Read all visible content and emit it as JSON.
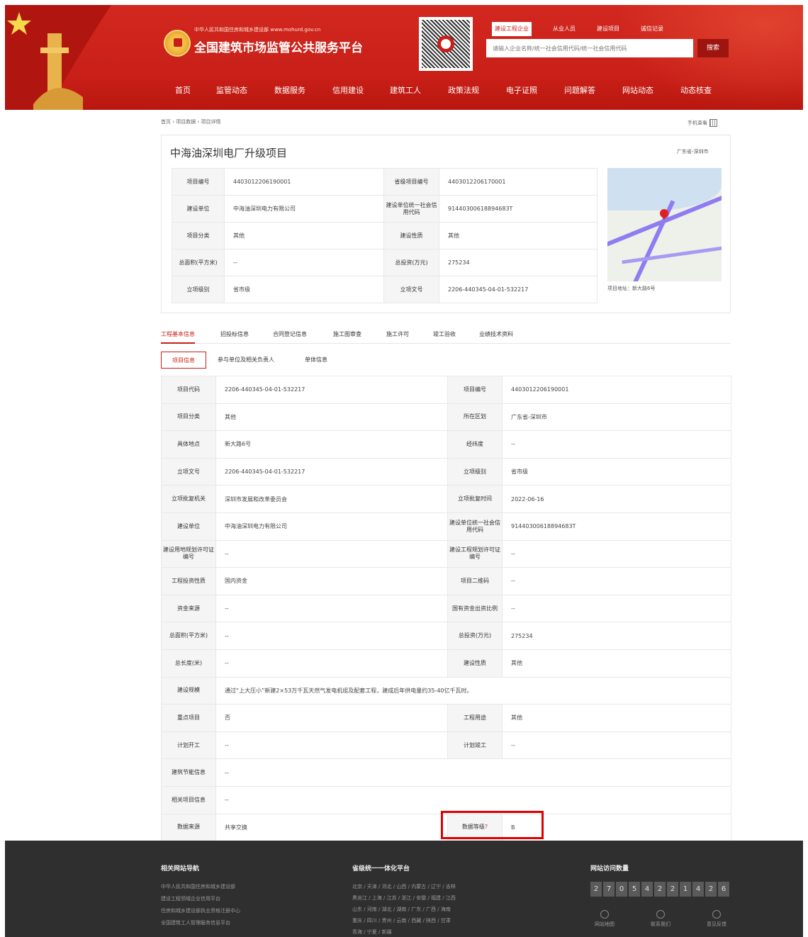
{
  "header": {
    "site_subtitle": "中华人民共和国住房和城乡建设部 www.mohurd.gov.cn",
    "site_title": "全国建筑市场监管公共服务平台",
    "search_tabs": [
      "建设工程企业",
      "从业人员",
      "建设项目",
      "诚信记录"
    ],
    "search_placeholder": "请输入企业名称/统一社会信用代码/统一社会信用代码",
    "search_button": "搜索",
    "nav": [
      "首页",
      "监管动态",
      "数据服务",
      "信用建设",
      "建筑工人",
      "政策法规",
      "电子证照",
      "问题解答",
      "网站动态",
      "动态核查"
    ]
  },
  "breadcrumb": "首页 › 项目数据 › 项目详情",
  "mobile_view": "手机查看",
  "project": {
    "title": "中海油深圳电厂升级项目",
    "region": "广东省-深圳市",
    "summary": [
      {
        "l1": "项目编号",
        "v1": "4403012206190001",
        "l2": "省级项目编号",
        "v2": "4403012206170001"
      },
      {
        "l1": "建设单位",
        "v1": "中海油深圳电力有限公司",
        "l2": "建设单位统一社会信用代码",
        "v2": "91440300618894683T"
      },
      {
        "l1": "项目分类",
        "v1": "其他",
        "l2": "建设性质",
        "v2": "其他"
      },
      {
        "l1": "总面积(平方米)",
        "v1": "--",
        "l2": "总投资(万元)",
        "v2": "275234"
      },
      {
        "l1": "立项级别",
        "v1": "省市级",
        "l2": "立项文号",
        "v2": "2206-440345-04-01-532217"
      }
    ],
    "map_address": "项目地址：新大路6号"
  },
  "main_tabs": [
    "工程基本信息",
    "招投标信息",
    "合同登记信息",
    "施工图审查",
    "施工许可",
    "竣工验收",
    "业绩技术资料"
  ],
  "sub_tabs": [
    "项目信息",
    "参与单位及相关负责人",
    "单体信息"
  ],
  "detail": [
    {
      "l1": "项目代码",
      "v1": "2206-440345-04-01-532217",
      "l2": "项目编号",
      "v2": "4403012206190001"
    },
    {
      "l1": "项目分类",
      "v1": "其他",
      "l2": "所在区划",
      "v2": "广东省-深圳市"
    },
    {
      "l1": "具体地点",
      "v1": "新大路6号",
      "l2": "经纬度",
      "v2": "--"
    },
    {
      "l1": "立项文号",
      "v1": "2206-440345-04-01-532217",
      "l2": "立项级别",
      "v2": "省市级"
    },
    {
      "l1": "立项批复机关",
      "v1": "深圳市发展和改革委员会",
      "l2": "立项批复时间",
      "v2": "2022-06-16"
    },
    {
      "l1": "建设单位",
      "v1": "中海油深圳电力有限公司",
      "l2": "建设单位统一社会信用代码",
      "v2": "91440300618894683T"
    },
    {
      "l1": "建设用地规划许可证编号",
      "v1": "--",
      "l2": "建设工程规划许可证编号",
      "v2": "--"
    },
    {
      "l1": "工程投资性质",
      "v1": "国内资金",
      "l2": "项目二维码",
      "v2": "--"
    },
    {
      "l1": "资金来源",
      "v1": "--",
      "l2": "国有资金出资比例",
      "v2": "--"
    },
    {
      "l1": "总面积(平方米)",
      "v1": "--",
      "l2": "总投资(万元)",
      "v2": "275234"
    },
    {
      "l1": "总长度(米)",
      "v1": "--",
      "l2": "建设性质",
      "v2": "其他"
    },
    {
      "l1": "建设规模",
      "v1": "通过“上大压小”新建2×53万千瓦天然气发电机组及配套工程，建成后年供电量约35-40亿千瓦时。",
      "full": true
    },
    {
      "l1": "重点项目",
      "v1": "否",
      "l2": "工程用途",
      "v2": "其他"
    },
    {
      "l1": "计划开工",
      "v1": "--",
      "l2": "计划竣工",
      "v2": "--"
    },
    {
      "l1": "建筑节能信息",
      "v1": "--",
      "full": true
    },
    {
      "l1": "相关项目信息",
      "v1": "--",
      "full": true
    },
    {
      "l1": "数据来源",
      "v1": "共享交换",
      "l2": "数据等级",
      "v2": "B",
      "star": "?"
    }
  ],
  "footer": {
    "col1_title": "相关网站导航",
    "col1_links": [
      "中华人民共和国住房和城乡建设部",
      "建设工程领域企业信用平台",
      "住房和城乡建设部执业资格注册中心",
      "全国建筑工人管理服务信息平台"
    ],
    "col2_title": "省级统一一体化平台",
    "col2_links": [
      "北京 / 天津 / 河北 / 山西 / 内蒙古 / 辽宁 / 吉林",
      "黑龙江 / 上海 / 江苏 / 浙江 / 安徽 / 福建 / 江西",
      "山东 / 河南 / 湖北 / 湖南 / 广东 / 广西 / 海南",
      "重庆 / 四川 / 贵州 / 云南 / 西藏 / 陕西 / 甘肃",
      "青海 / 宁夏 / 新疆"
    ],
    "col3_title": "网站访问数量",
    "counter": [
      "2",
      "7",
      "0",
      "5",
      "4",
      "2",
      "2",
      "1",
      "4",
      "2",
      "6"
    ],
    "icons": [
      "网站地图",
      "联系我们",
      "意见反馈"
    ]
  }
}
